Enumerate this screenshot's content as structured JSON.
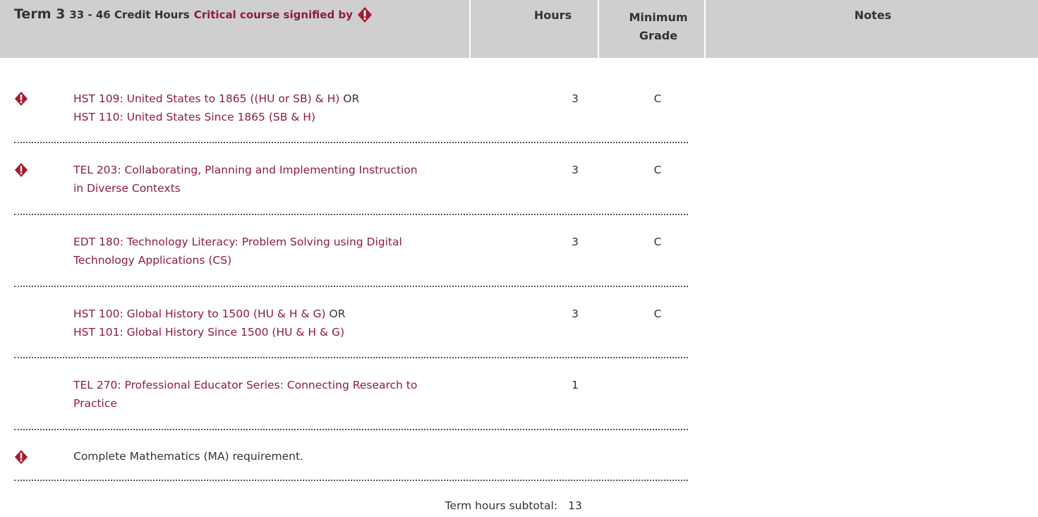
{
  "header": {
    "term": "Term 3",
    "credit_hours": "33 - 46 Credit Hours",
    "critical_label": "Critical course signified by",
    "hours": "Hours",
    "min_grade_line1": "Minimum",
    "min_grade_line2": "Grade",
    "notes": "Notes"
  },
  "icons": {
    "critical": "critical-diamond-icon",
    "critical_color": "#a6192e"
  },
  "colors": {
    "link": "#8c1d40",
    "header_bg": "#cfcfcf",
    "text": "#333333"
  },
  "rows": [
    {
      "critical": true,
      "line1_link": "HST 109: United States to 1865 ((HU or SB) & H)",
      "line1_or": " OR",
      "line2_link": "HST 110: United States Since 1865 (SB & H)",
      "hours": "3",
      "grade": "C"
    },
    {
      "critical": true,
      "line1_link": "TEL 203: Collaborating, Planning and Implementing Instruction",
      "line2_link": "in Diverse Contexts",
      "hours": "3",
      "grade": "C"
    },
    {
      "critical": false,
      "line1_link": "EDT 180: Technology Literacy: Problem Solving using Digital",
      "line2_link": "Technology Applications (CS)",
      "hours": "3",
      "grade": "C"
    },
    {
      "critical": false,
      "line1_link": "HST 100: Global History to 1500 (HU & H & G)",
      "line1_or": " OR",
      "line2_link": "HST 101: Global History Since 1500 (HU & H & G)",
      "hours": "3",
      "grade": "C"
    },
    {
      "critical": false,
      "line1_link": "TEL 270: Professional Educator Series: Connecting Research to",
      "line2_link": "Practice",
      "hours": "1",
      "grade": ""
    },
    {
      "critical": true,
      "line1_text": "Complete Mathematics (MA) requirement.",
      "hours": "",
      "grade": ""
    }
  ],
  "subtotal": {
    "label": "Term hours subtotal:",
    "value": "13"
  }
}
